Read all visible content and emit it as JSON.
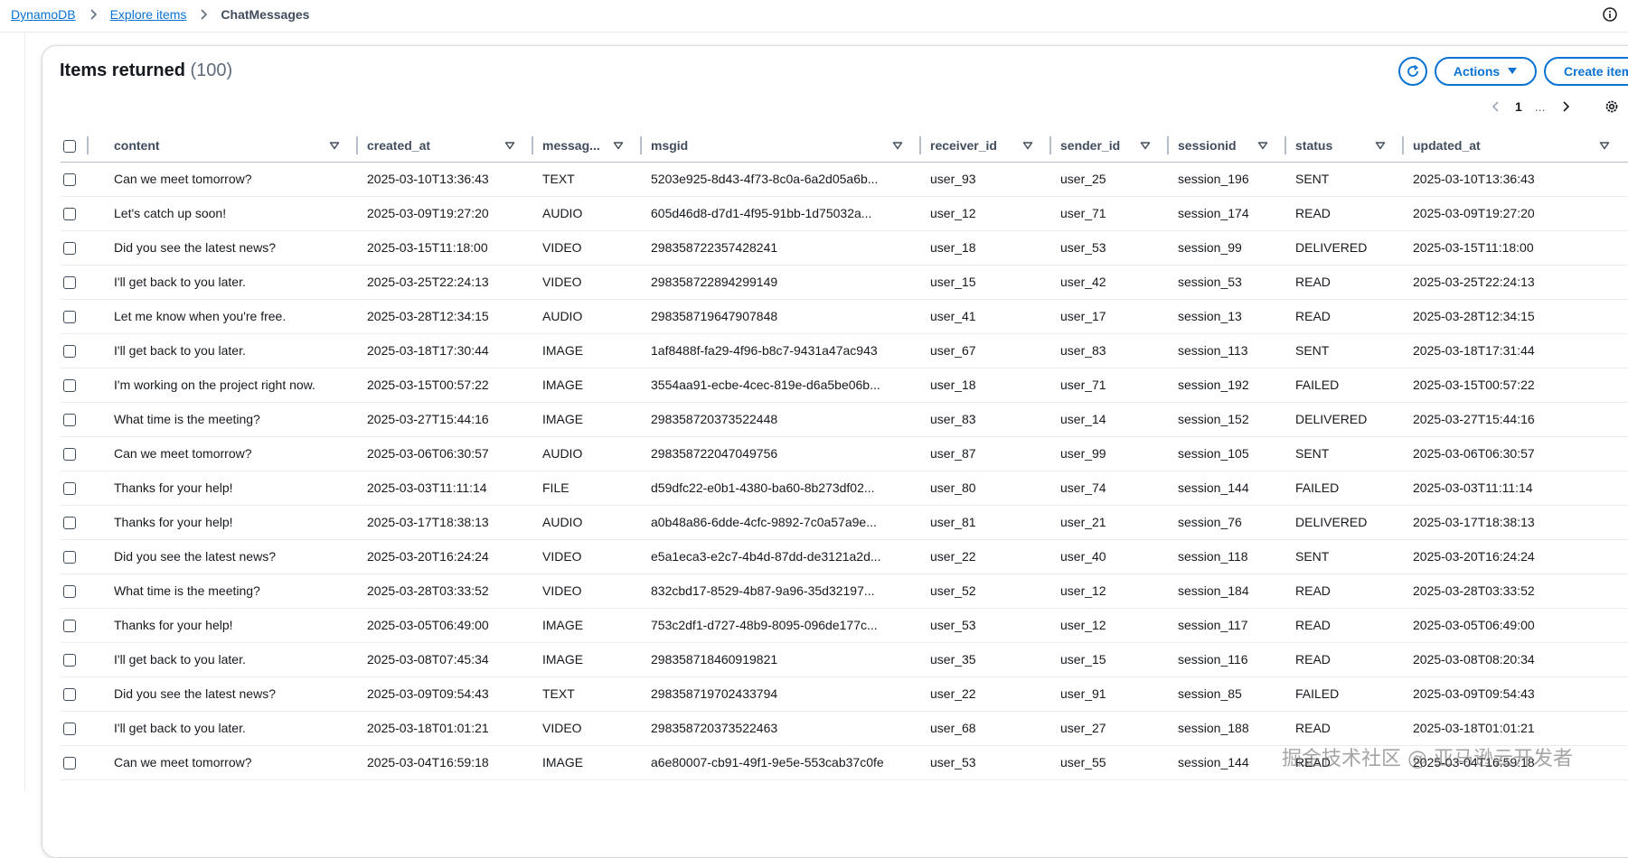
{
  "breadcrumb": {
    "items": [
      "DynamoDB",
      "Explore items"
    ],
    "current": "ChatMessages"
  },
  "panel": {
    "title": "Items returned",
    "count": "(100)",
    "actions_label": "Actions",
    "create_label": "Create item"
  },
  "pagination": {
    "current_page": "1",
    "ellipsis": "..."
  },
  "table": {
    "columns": [
      "content",
      "created_at",
      "messag...",
      "msgid",
      "receiver_id",
      "sender_id",
      "sessionid",
      "status",
      "updated_at"
    ],
    "rows": [
      [
        "Can we meet tomorrow?",
        "2025-03-10T13:36:43",
        "TEXT",
        "5203e925-8d43-4f73-8c0a-6a2d05a6b...",
        "user_93",
        "user_25",
        "session_196",
        "SENT",
        "2025-03-10T13:36:43"
      ],
      [
        "Let's catch up soon!",
        "2025-03-09T19:27:20",
        "AUDIO",
        "605d46d8-d7d1-4f95-91bb-1d75032a...",
        "user_12",
        "user_71",
        "session_174",
        "READ",
        "2025-03-09T19:27:20"
      ],
      [
        "Did you see the latest news?",
        "2025-03-15T11:18:00",
        "VIDEO",
        "298358722357428241",
        "user_18",
        "user_53",
        "session_99",
        "DELIVERED",
        "2025-03-15T11:18:00"
      ],
      [
        "I'll get back to you later.",
        "2025-03-25T22:24:13",
        "VIDEO",
        "298358722894299149",
        "user_15",
        "user_42",
        "session_53",
        "READ",
        "2025-03-25T22:24:13"
      ],
      [
        "Let me know when you're free.",
        "2025-03-28T12:34:15",
        "AUDIO",
        "298358719647907848",
        "user_41",
        "user_17",
        "session_13",
        "READ",
        "2025-03-28T12:34:15"
      ],
      [
        "I'll get back to you later.",
        "2025-03-18T17:30:44",
        "IMAGE",
        "1af8488f-fa29-4f96-b8c7-9431a47ac943",
        "user_67",
        "user_83",
        "session_113",
        "SENT",
        "2025-03-18T17:31:44"
      ],
      [
        "I'm working on the project right now.",
        "2025-03-15T00:57:22",
        "IMAGE",
        "3554aa91-ecbe-4cec-819e-d6a5be06b...",
        "user_18",
        "user_71",
        "session_192",
        "FAILED",
        "2025-03-15T00:57:22"
      ],
      [
        "What time is the meeting?",
        "2025-03-27T15:44:16",
        "IMAGE",
        "298358720373522448",
        "user_83",
        "user_14",
        "session_152",
        "DELIVERED",
        "2025-03-27T15:44:16"
      ],
      [
        "Can we meet tomorrow?",
        "2025-03-06T06:30:57",
        "AUDIO",
        "298358722047049756",
        "user_87",
        "user_99",
        "session_105",
        "SENT",
        "2025-03-06T06:30:57"
      ],
      [
        "Thanks for your help!",
        "2025-03-03T11:11:14",
        "FILE",
        "d59dfc22-e0b1-4380-ba60-8b273df02...",
        "user_80",
        "user_74",
        "session_144",
        "FAILED",
        "2025-03-03T11:11:14"
      ],
      [
        "Thanks for your help!",
        "2025-03-17T18:38:13",
        "AUDIO",
        "a0b48a86-6dde-4cfc-9892-7c0a57a9e...",
        "user_81",
        "user_21",
        "session_76",
        "DELIVERED",
        "2025-03-17T18:38:13"
      ],
      [
        "Did you see the latest news?",
        "2025-03-20T16:24:24",
        "VIDEO",
        "e5a1eca3-e2c7-4b4d-87dd-de3121a2d...",
        "user_22",
        "user_40",
        "session_118",
        "SENT",
        "2025-03-20T16:24:24"
      ],
      [
        "What time is the meeting?",
        "2025-03-28T03:33:52",
        "VIDEO",
        "832cbd17-8529-4b87-9a96-35d32197...",
        "user_52",
        "user_12",
        "session_184",
        "READ",
        "2025-03-28T03:33:52"
      ],
      [
        "Thanks for your help!",
        "2025-03-05T06:49:00",
        "IMAGE",
        "753c2df1-d727-48b9-8095-096de177c...",
        "user_53",
        "user_12",
        "session_117",
        "READ",
        "2025-03-05T06:49:00"
      ],
      [
        "I'll get back to you later.",
        "2025-03-08T07:45:34",
        "IMAGE",
        "298358718460919821",
        "user_35",
        "user_15",
        "session_116",
        "READ",
        "2025-03-08T08:20:34"
      ],
      [
        "Did you see the latest news?",
        "2025-03-09T09:54:43",
        "TEXT",
        "298358719702433794",
        "user_22",
        "user_91",
        "session_85",
        "FAILED",
        "2025-03-09T09:54:43"
      ],
      [
        "I'll get back to you later.",
        "2025-03-18T01:01:21",
        "VIDEO",
        "298358720373522463",
        "user_68",
        "user_27",
        "session_188",
        "READ",
        "2025-03-18T01:01:21"
      ],
      [
        "Can we meet tomorrow?",
        "2025-03-04T16:59:18",
        "IMAGE",
        "a6e80007-cb91-49f1-9e5e-553cab37c0fe",
        "user_53",
        "user_55",
        "session_144",
        "READ",
        "2025-03-04T16:59:18"
      ]
    ]
  },
  "watermark": "掘金技术社区 @ 亚马逊云开发者",
  "colors": {
    "accent": "#0972d3",
    "text": "#16191f",
    "muted": "#5f6b7a",
    "border": "#e9ebed"
  }
}
